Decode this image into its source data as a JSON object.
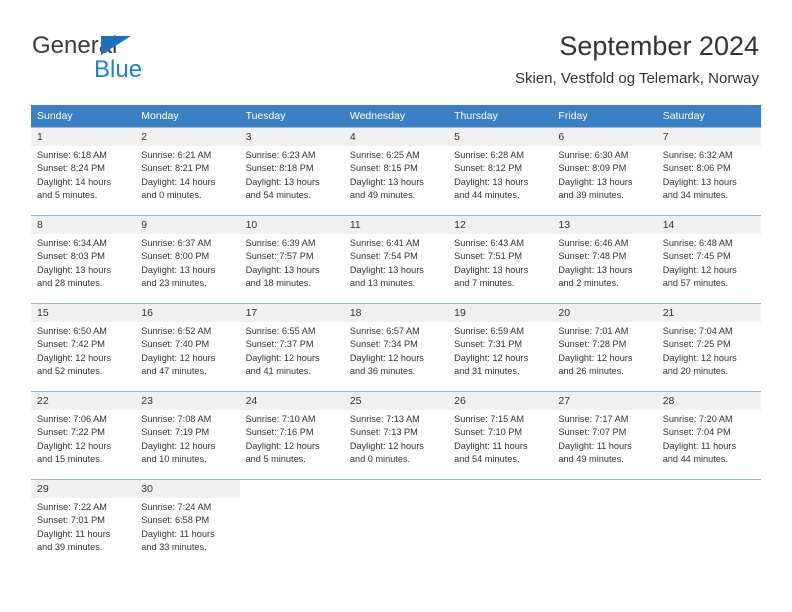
{
  "brand": {
    "word1": "General",
    "word2": "Blue",
    "triangle_color": "#1f6fb8",
    "blue_text_color": "#1f7fd0"
  },
  "header": {
    "title": "September 2024",
    "subtitle": "Skien, Vestfold og Telemark, Norway"
  },
  "calendar": {
    "accent_color": "#3b7fc4",
    "daynum_band_color": "#f0f0f0",
    "grid_line_color": "#9ab8d8",
    "weekday_headers": [
      "Sunday",
      "Monday",
      "Tuesday",
      "Wednesday",
      "Thursday",
      "Friday",
      "Saturday"
    ],
    "weeks": [
      [
        {
          "day": "1",
          "sunrise": "Sunrise: 6:18 AM",
          "sunset": "Sunset: 8:24 PM",
          "daylight_1": "Daylight: 14 hours",
          "daylight_2": "and 5 minutes."
        },
        {
          "day": "2",
          "sunrise": "Sunrise: 6:21 AM",
          "sunset": "Sunset: 8:21 PM",
          "daylight_1": "Daylight: 14 hours",
          "daylight_2": "and 0 minutes."
        },
        {
          "day": "3",
          "sunrise": "Sunrise: 6:23 AM",
          "sunset": "Sunset: 8:18 PM",
          "daylight_1": "Daylight: 13 hours",
          "daylight_2": "and 54 minutes."
        },
        {
          "day": "4",
          "sunrise": "Sunrise: 6:25 AM",
          "sunset": "Sunset: 8:15 PM",
          "daylight_1": "Daylight: 13 hours",
          "daylight_2": "and 49 minutes."
        },
        {
          "day": "5",
          "sunrise": "Sunrise: 6:28 AM",
          "sunset": "Sunset: 8:12 PM",
          "daylight_1": "Daylight: 13 hours",
          "daylight_2": "and 44 minutes."
        },
        {
          "day": "6",
          "sunrise": "Sunrise: 6:30 AM",
          "sunset": "Sunset: 8:09 PM",
          "daylight_1": "Daylight: 13 hours",
          "daylight_2": "and 39 minutes."
        },
        {
          "day": "7",
          "sunrise": "Sunrise: 6:32 AM",
          "sunset": "Sunset: 8:06 PM",
          "daylight_1": "Daylight: 13 hours",
          "daylight_2": "and 34 minutes."
        }
      ],
      [
        {
          "day": "8",
          "sunrise": "Sunrise: 6:34 AM",
          "sunset": "Sunset: 8:03 PM",
          "daylight_1": "Daylight: 13 hours",
          "daylight_2": "and 28 minutes."
        },
        {
          "day": "9",
          "sunrise": "Sunrise: 6:37 AM",
          "sunset": "Sunset: 8:00 PM",
          "daylight_1": "Daylight: 13 hours",
          "daylight_2": "and 23 minutes."
        },
        {
          "day": "10",
          "sunrise": "Sunrise: 6:39 AM",
          "sunset": "Sunset: 7:57 PM",
          "daylight_1": "Daylight: 13 hours",
          "daylight_2": "and 18 minutes."
        },
        {
          "day": "11",
          "sunrise": "Sunrise: 6:41 AM",
          "sunset": "Sunset: 7:54 PM",
          "daylight_1": "Daylight: 13 hours",
          "daylight_2": "and 13 minutes."
        },
        {
          "day": "12",
          "sunrise": "Sunrise: 6:43 AM",
          "sunset": "Sunset: 7:51 PM",
          "daylight_1": "Daylight: 13 hours",
          "daylight_2": "and 7 minutes."
        },
        {
          "day": "13",
          "sunrise": "Sunrise: 6:46 AM",
          "sunset": "Sunset: 7:48 PM",
          "daylight_1": "Daylight: 13 hours",
          "daylight_2": "and 2 minutes."
        },
        {
          "day": "14",
          "sunrise": "Sunrise: 6:48 AM",
          "sunset": "Sunset: 7:45 PM",
          "daylight_1": "Daylight: 12 hours",
          "daylight_2": "and 57 minutes."
        }
      ],
      [
        {
          "day": "15",
          "sunrise": "Sunrise: 6:50 AM",
          "sunset": "Sunset: 7:42 PM",
          "daylight_1": "Daylight: 12 hours",
          "daylight_2": "and 52 minutes."
        },
        {
          "day": "16",
          "sunrise": "Sunrise: 6:52 AM",
          "sunset": "Sunset: 7:40 PM",
          "daylight_1": "Daylight: 12 hours",
          "daylight_2": "and 47 minutes."
        },
        {
          "day": "17",
          "sunrise": "Sunrise: 6:55 AM",
          "sunset": "Sunset: 7:37 PM",
          "daylight_1": "Daylight: 12 hours",
          "daylight_2": "and 41 minutes."
        },
        {
          "day": "18",
          "sunrise": "Sunrise: 6:57 AM",
          "sunset": "Sunset: 7:34 PM",
          "daylight_1": "Daylight: 12 hours",
          "daylight_2": "and 36 minutes."
        },
        {
          "day": "19",
          "sunrise": "Sunrise: 6:59 AM",
          "sunset": "Sunset: 7:31 PM",
          "daylight_1": "Daylight: 12 hours",
          "daylight_2": "and 31 minutes."
        },
        {
          "day": "20",
          "sunrise": "Sunrise: 7:01 AM",
          "sunset": "Sunset: 7:28 PM",
          "daylight_1": "Daylight: 12 hours",
          "daylight_2": "and 26 minutes."
        },
        {
          "day": "21",
          "sunrise": "Sunrise: 7:04 AM",
          "sunset": "Sunset: 7:25 PM",
          "daylight_1": "Daylight: 12 hours",
          "daylight_2": "and 20 minutes."
        }
      ],
      [
        {
          "day": "22",
          "sunrise": "Sunrise: 7:06 AM",
          "sunset": "Sunset: 7:22 PM",
          "daylight_1": "Daylight: 12 hours",
          "daylight_2": "and 15 minutes."
        },
        {
          "day": "23",
          "sunrise": "Sunrise: 7:08 AM",
          "sunset": "Sunset: 7:19 PM",
          "daylight_1": "Daylight: 12 hours",
          "daylight_2": "and 10 minutes."
        },
        {
          "day": "24",
          "sunrise": "Sunrise: 7:10 AM",
          "sunset": "Sunset: 7:16 PM",
          "daylight_1": "Daylight: 12 hours",
          "daylight_2": "and 5 minutes."
        },
        {
          "day": "25",
          "sunrise": "Sunrise: 7:13 AM",
          "sunset": "Sunset: 7:13 PM",
          "daylight_1": "Daylight: 12 hours",
          "daylight_2": "and 0 minutes."
        },
        {
          "day": "26",
          "sunrise": "Sunrise: 7:15 AM",
          "sunset": "Sunset: 7:10 PM",
          "daylight_1": "Daylight: 11 hours",
          "daylight_2": "and 54 minutes."
        },
        {
          "day": "27",
          "sunrise": "Sunrise: 7:17 AM",
          "sunset": "Sunset: 7:07 PM",
          "daylight_1": "Daylight: 11 hours",
          "daylight_2": "and 49 minutes."
        },
        {
          "day": "28",
          "sunrise": "Sunrise: 7:20 AM",
          "sunset": "Sunset: 7:04 PM",
          "daylight_1": "Daylight: 11 hours",
          "daylight_2": "and 44 minutes."
        }
      ],
      [
        {
          "day": "29",
          "sunrise": "Sunrise: 7:22 AM",
          "sunset": "Sunset: 7:01 PM",
          "daylight_1": "Daylight: 11 hours",
          "daylight_2": "and 39 minutes."
        },
        {
          "day": "30",
          "sunrise": "Sunrise: 7:24 AM",
          "sunset": "Sunset: 6:58 PM",
          "daylight_1": "Daylight: 11 hours",
          "daylight_2": "and 33 minutes."
        },
        {
          "day": "",
          "sunrise": "",
          "sunset": "",
          "daylight_1": "",
          "daylight_2": ""
        },
        {
          "day": "",
          "sunrise": "",
          "sunset": "",
          "daylight_1": "",
          "daylight_2": ""
        },
        {
          "day": "",
          "sunrise": "",
          "sunset": "",
          "daylight_1": "",
          "daylight_2": ""
        },
        {
          "day": "",
          "sunrise": "",
          "sunset": "",
          "daylight_1": "",
          "daylight_2": ""
        },
        {
          "day": "",
          "sunrise": "",
          "sunset": "",
          "daylight_1": "",
          "daylight_2": ""
        }
      ]
    ]
  }
}
